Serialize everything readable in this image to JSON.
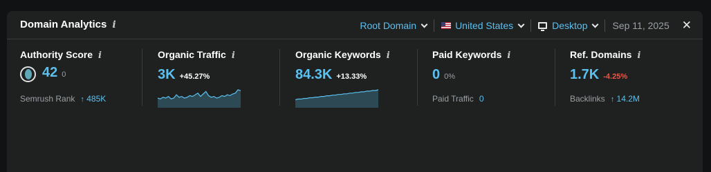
{
  "header": {
    "title": "Domain Analytics",
    "info_glyph": "i",
    "scope_label": "Root Domain",
    "country_label": "United States",
    "country_icon": "us-flag-icon",
    "device_label": "Desktop",
    "device_icon": "monitor-icon",
    "date": "Sep 11, 2025",
    "close_glyph": "✕"
  },
  "metrics": {
    "authority": {
      "label": "Authority Score",
      "value": "42",
      "delta": "0",
      "sub_label": "Semrush Rank",
      "sub_value": "485K",
      "sub_arrow": "↑"
    },
    "organic_traffic": {
      "label": "Organic Traffic",
      "value": "3K",
      "delta": "+45.27%"
    },
    "organic_keywords": {
      "label": "Organic Keywords",
      "value": "84.3K",
      "delta": "+13.33%"
    },
    "paid_keywords": {
      "label": "Paid Keywords",
      "value": "0",
      "delta": "0%",
      "sub_label": "Paid Traffic",
      "sub_value": "0"
    },
    "ref_domains": {
      "label": "Ref. Domains",
      "value": "1.7K",
      "delta": "-4.25%",
      "sub_label": "Backlinks",
      "sub_value": "14.2M",
      "sub_arrow": "↑"
    }
  },
  "colors": {
    "accent": "#5bc0f0",
    "negative": "#e8574a",
    "background": "#1f2121",
    "spark_fill": "#2d4a54"
  },
  "sparklines": {
    "organic_traffic": [
      10,
      9,
      11,
      10,
      12,
      9,
      10,
      14,
      11,
      12,
      10,
      11,
      13,
      12,
      14,
      16,
      12,
      15,
      18,
      13,
      11,
      12,
      10,
      11,
      13,
      12,
      14,
      13,
      15,
      16,
      20,
      19
    ],
    "organic_keywords": [
      10,
      11,
      11,
      12,
      12,
      13,
      13,
      14,
      14,
      15,
      15,
      16,
      16,
      17,
      17,
      18,
      18,
      19,
      19,
      20,
      20,
      21,
      21,
      22,
      22,
      23,
      23,
      24,
      24,
      25
    ]
  }
}
